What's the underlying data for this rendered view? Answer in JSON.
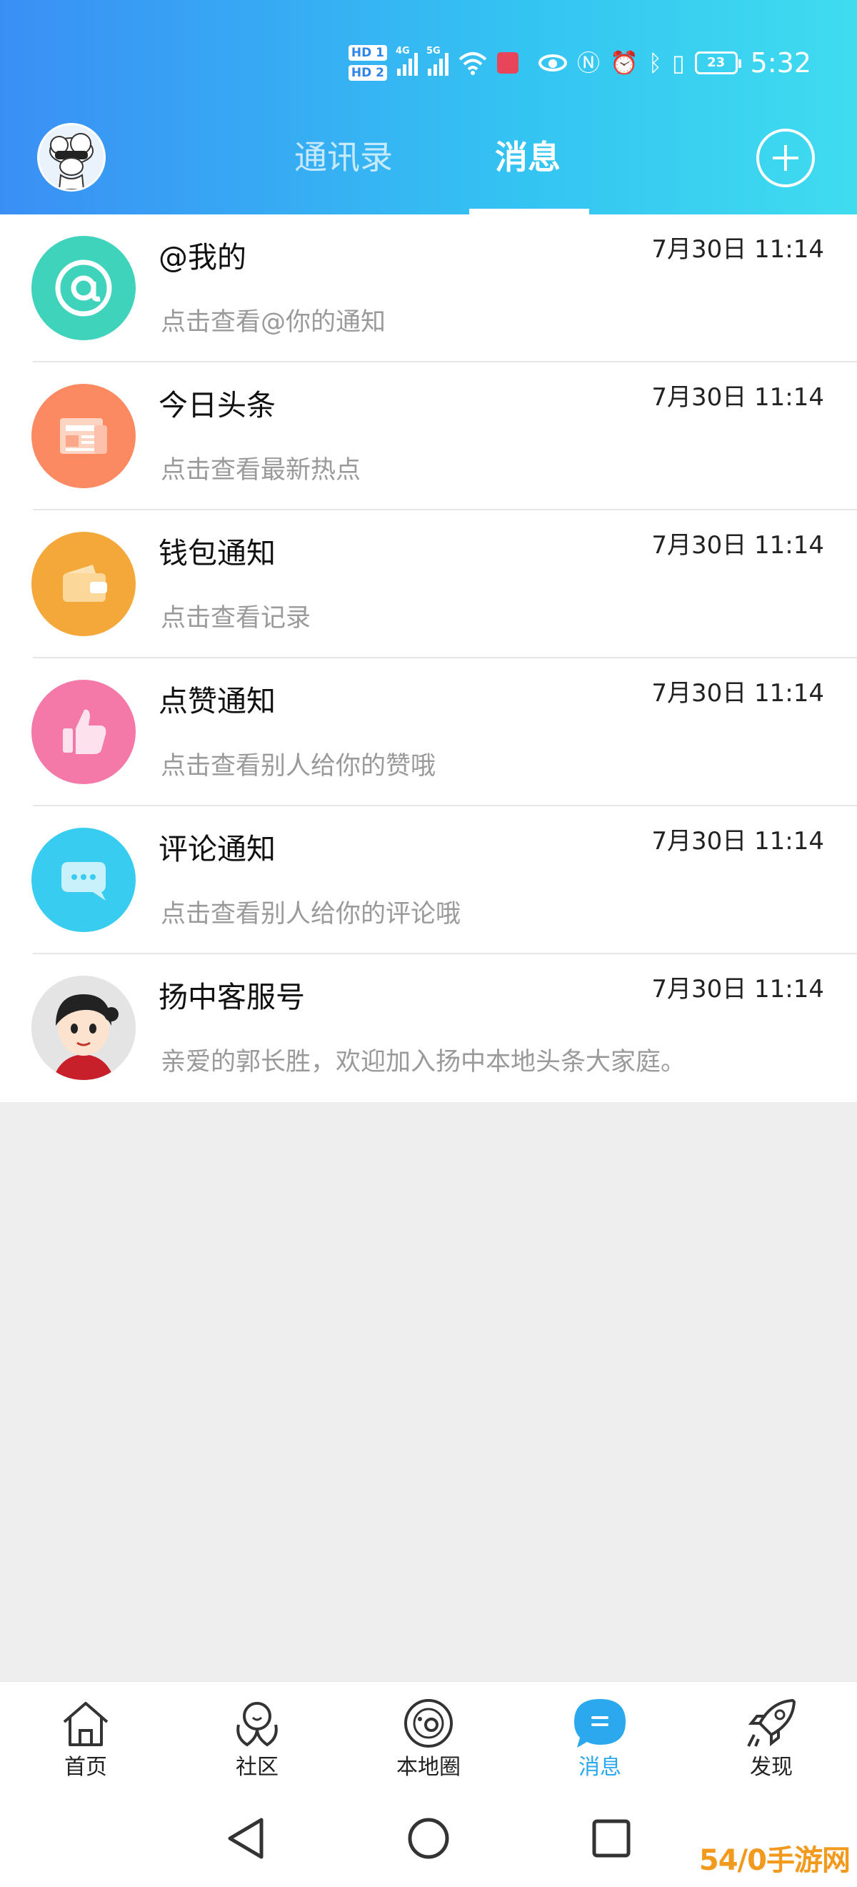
{
  "status_bar": {
    "sim1": "HD 1",
    "sim2": "HD 2",
    "net1": "4G",
    "net2": "5G",
    "battery": "23",
    "clock": "5:32"
  },
  "header": {
    "tabs": [
      {
        "label": "通讯录",
        "active": false
      },
      {
        "label": "消息",
        "active": true
      }
    ],
    "accent_color": "#3a8ff5"
  },
  "messages": [
    {
      "title": "@我的",
      "time": "7月30日 11:14",
      "subtitle": "点击查看@你的通知",
      "icon": "at-icon",
      "color": "#3fd3bb"
    },
    {
      "title": "今日头条",
      "time": "7月30日 11:14",
      "subtitle": "点击查看最新热点",
      "icon": "newspaper-icon",
      "color": "#fb8a63"
    },
    {
      "title": "钱包通知",
      "time": "7月30日 11:14",
      "subtitle": "点击查看记录",
      "icon": "wallet-icon",
      "color": "#f5a83a"
    },
    {
      "title": "点赞通知",
      "time": "7月30日 11:14",
      "subtitle": "点击查看别人给你的赞哦",
      "icon": "thumbs-up-icon",
      "color": "#f478a8"
    },
    {
      "title": "评论通知",
      "time": "7月30日 11:14",
      "subtitle": "点击查看别人给你的评论哦",
      "icon": "comment-bubble-icon",
      "color": "#38cdf0"
    },
    {
      "title": "扬中客服号",
      "time": "7月30日 11:14",
      "subtitle": "亲爱的郭长胜，欢迎加入扬中本地头条大家庭。",
      "icon": "customer-service-avatar",
      "color": "#cccccc"
    }
  ],
  "bottom_nav": [
    {
      "label": "首页",
      "icon": "home-icon",
      "active": false
    },
    {
      "label": "社区",
      "icon": "community-icon",
      "active": false
    },
    {
      "label": "本地圈",
      "icon": "planet-icon",
      "active": false
    },
    {
      "label": "消息",
      "icon": "message-icon",
      "active": true
    },
    {
      "label": "发现",
      "icon": "rocket-icon",
      "active": false
    }
  ],
  "watermark": "54/0手游网"
}
